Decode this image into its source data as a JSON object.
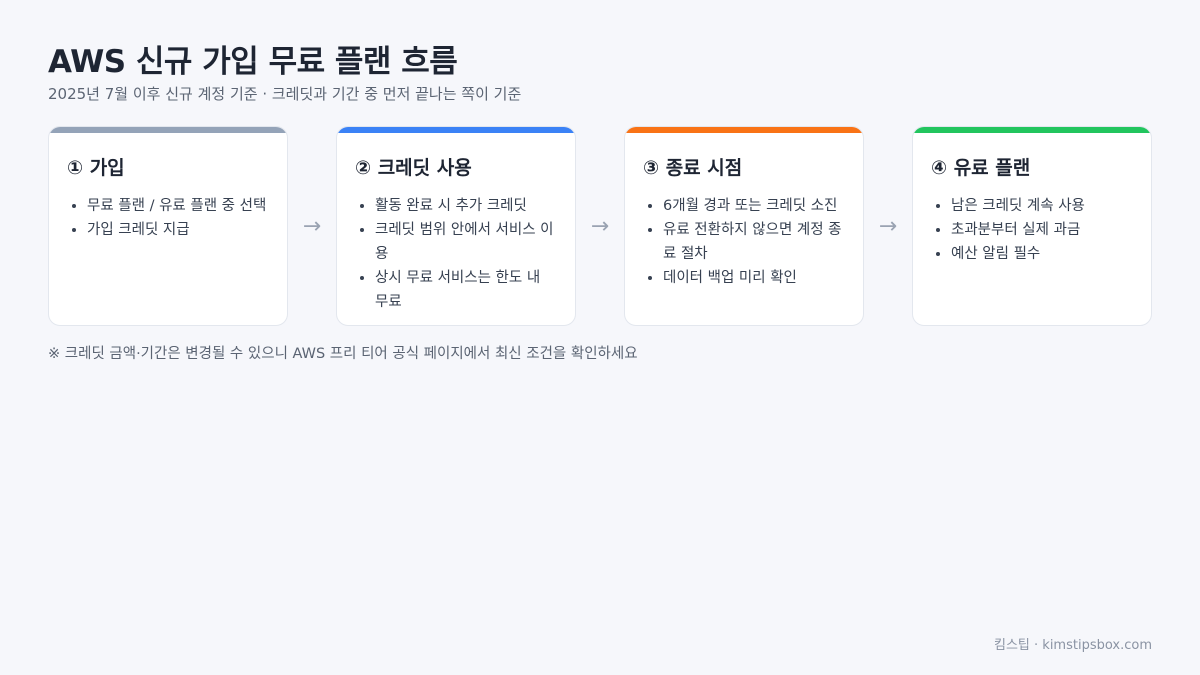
{
  "header": {
    "title": "AWS 신규 가입 무료 플랜 흐름",
    "subtitle": "2025년 7월 이후 신규 계정 기준 · 크레딧과 기간 중 먼저 끝나는 쪽이 기준"
  },
  "arrow_glyph": "→",
  "steps": [
    {
      "title": "① 가입",
      "accent": "#94a3b8",
      "items": [
        "무료 플랜 / 유료 플랜 중 선택",
        "가입 크레딧 지급"
      ]
    },
    {
      "title": "② 크레딧 사용",
      "accent": "#3b82f6",
      "items": [
        "활동 완료 시 추가 크레딧",
        "크레딧 범위 안에서 서비스 이용",
        "상시 무료 서비스는 한도 내 무료"
      ]
    },
    {
      "title": "③ 종료 시점",
      "accent": "#f97316",
      "items": [
        "6개월 경과 또는 크레딧 소진",
        "유료 전환하지 않으면 계정 종료 절차",
        "데이터 백업 미리 확인"
      ]
    },
    {
      "title": "④ 유료 플랜",
      "accent": "#22c55e",
      "items": [
        "남은 크레딧 계속 사용",
        "초과분부터 실제 과금",
        "예산 알림 필수"
      ]
    }
  ],
  "note": "※ 크레딧 금액·기간은 변경될 수 있으니 AWS 프리 티어 공식 페이지에서 최신 조건을 확인하세요",
  "footer": "킴스팁 · kimstipsbox.com"
}
